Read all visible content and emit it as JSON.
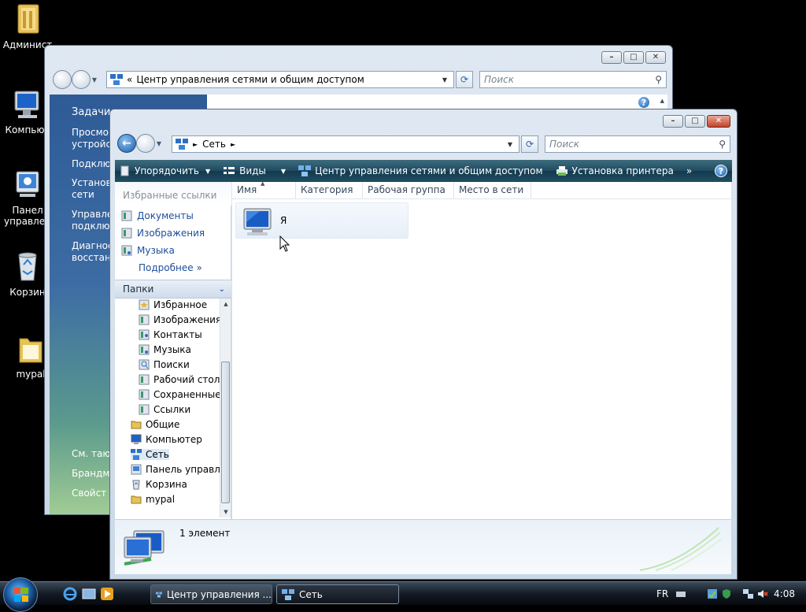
{
  "desktop": {
    "icons": [
      {
        "label": "Админист",
        "kind": "folder-user"
      },
      {
        "label": "Компьют",
        "kind": "computer"
      },
      {
        "label": "Панел\nуправлен",
        "kind": "control-panel"
      },
      {
        "label": "Корзин",
        "kind": "recycle-bin"
      },
      {
        "label": "mypal",
        "kind": "folder"
      }
    ]
  },
  "back_window": {
    "address": "Центр управления сетями и общим доступом",
    "address_prefix": "«",
    "search_placeholder": "Поиск",
    "tasks": [
      "Задачи",
      "Просмо",
      "устройс",
      "Подклю",
      "Установ",
      "сети",
      "Управле",
      "подклю",
      "Диагнос",
      "восстано"
    ],
    "see_also": [
      "См. таю",
      "Брандма",
      "Свойст"
    ]
  },
  "front_window": {
    "address_root": "Сеть",
    "search_placeholder": "Поиск",
    "toolbar": {
      "organize": "Упорядочить",
      "views": "Виды",
      "network_center": "Центр управления сетями и общим доступом",
      "add_printer": "Установка принтера",
      "more": "»"
    },
    "favorites": {
      "header": "Избранные ссылки",
      "links": [
        "Документы",
        "Изображения",
        "Музыка"
      ],
      "more": "Подробнее"
    },
    "folders": {
      "header": "Папки",
      "items": [
        {
          "label": "Избранное",
          "icon": "favorites-folder-icon"
        },
        {
          "label": "Изображения",
          "icon": "pictures-folder-icon"
        },
        {
          "label": "Контакты",
          "icon": "contacts-folder-icon"
        },
        {
          "label": "Музыка",
          "icon": "music-folder-icon"
        },
        {
          "label": "Поиски",
          "icon": "searches-folder-icon"
        },
        {
          "label": "Рабочий стол",
          "icon": "desktop-folder-icon"
        },
        {
          "label": "Сохраненные",
          "icon": "saved-games-folder-icon"
        },
        {
          "label": "Ссылки",
          "icon": "links-folder-icon"
        },
        {
          "label": "Общие",
          "icon": "folder-icon"
        },
        {
          "label": "Компьютер",
          "icon": "computer-icon"
        },
        {
          "label": "Сеть",
          "icon": "network-icon",
          "selected": true
        },
        {
          "label": "Панель управле",
          "icon": "control-panel-icon"
        },
        {
          "label": "Корзина",
          "icon": "recycle-bin-icon"
        },
        {
          "label": "mypal",
          "icon": "folder-icon"
        }
      ]
    },
    "columns": [
      "Имя",
      "Категория",
      "Рабочая группа",
      "Место в сети"
    ],
    "items": [
      {
        "name": "Я"
      }
    ],
    "status": "1 элемент"
  },
  "taskbar": {
    "buttons": [
      {
        "label": "Центр управления ...",
        "active": false
      },
      {
        "label": "Сеть",
        "active": true
      }
    ],
    "tray": {
      "language": "FR",
      "clock": "4:08"
    }
  },
  "colors": {
    "vista_blue": "#1b5aa8",
    "link_blue": "#1e4e9a",
    "toolbar_dark": "#1f4a60",
    "close_red": "#c0432c"
  }
}
